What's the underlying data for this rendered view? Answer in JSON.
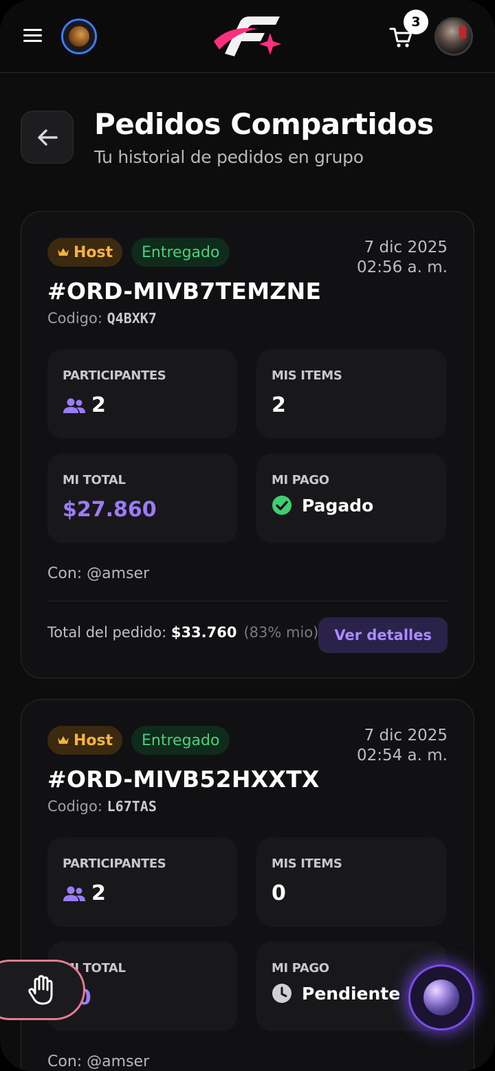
{
  "header": {
    "cart_count": "3"
  },
  "page": {
    "title": "Pedidos Compartidos",
    "subtitle": "Tu historial de pedidos en grupo"
  },
  "labels": {
    "participants": "PARTICIPANTES",
    "my_items": "MIS ITEMS",
    "my_total": "MI TOTAL",
    "my_payment": "MI PAGO",
    "code_prefix": "Codigo: ",
    "order_total_prefix": "Total del pedido: ",
    "details_button": "Ver detalles"
  },
  "orders": [
    {
      "role": "Host",
      "status": "Entregado",
      "date": "7 dic 2025",
      "time": "02:56 a. m.",
      "id": "#ORD-MIVB7TEMZNE",
      "code": "Q4BXK7",
      "participants": "2",
      "my_items": "2",
      "my_total": "$27.860",
      "payment_status": "Pagado",
      "with": "Con: @amser",
      "order_total": "$33.760",
      "share": "(83% mio)"
    },
    {
      "role": "Host",
      "status": "Entregado",
      "date": "7 dic 2025",
      "time": "02:54 a. m.",
      "id": "#ORD-MIVB52HXXTX",
      "code": "L67TAS",
      "participants": "2",
      "my_items": "0",
      "my_total": "$0",
      "payment_status": "Pendiente",
      "with": "Con: @amser"
    }
  ],
  "colors": {
    "accent_purple": "#9b7bf7",
    "host_gold": "#f4b53a",
    "status_green": "#4ad27a",
    "logo_pink": "#ff2e7e"
  },
  "icons": [
    "menu-icon",
    "planet-icon",
    "brand-logo",
    "cart-icon",
    "back-arrow-icon",
    "crown-icon",
    "users-icon",
    "check-circle-icon",
    "clock-icon",
    "hand-icon",
    "assistant-orb-icon"
  ]
}
